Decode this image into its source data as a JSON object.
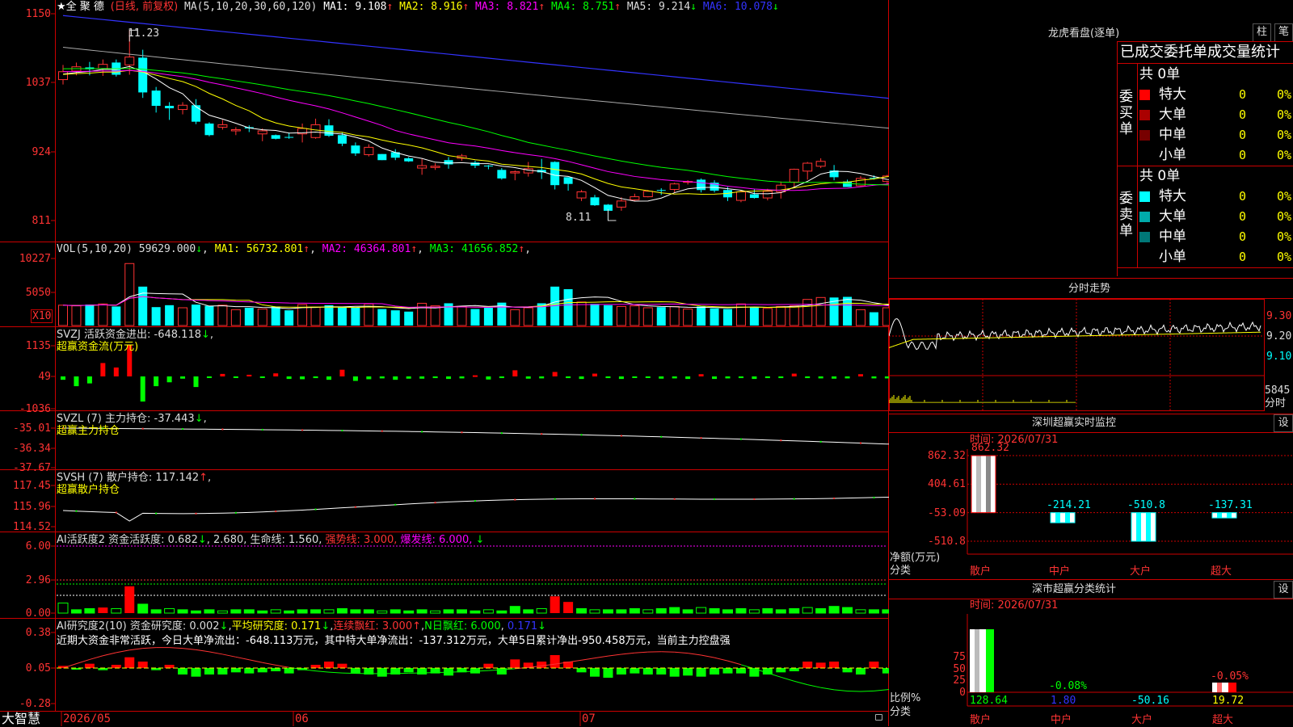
{
  "main_chart": {
    "title": "★全 聚 德",
    "period": "(日线, 前复权)",
    "ma_params": "MA(5,10,20,30,60,120)",
    "ma_values": [
      {
        "label": "MA1:",
        "value": "9.108",
        "arrow": "↑",
        "color": "#ffffff"
      },
      {
        "label": "MA2:",
        "value": "8.916",
        "arrow": "↑",
        "color": "#ffff00"
      },
      {
        "label": "MA3:",
        "value": "8.821",
        "arrow": "↑",
        "color": "#ff00ff"
      },
      {
        "label": "MA4:",
        "value": "8.751",
        "arrow": "↑",
        "color": "#00ff00"
      },
      {
        "label": "MA5:",
        "value": "9.214",
        "arrow": "↓",
        "color": "#dddddd"
      },
      {
        "label": "MA6:",
        "value": "10.078",
        "arrow": "↓",
        "color": "#3333ff"
      }
    ],
    "y_ticks": [
      "1150",
      "1037",
      "924",
      "811"
    ],
    "high_label": "11.23",
    "low_label": "8.11",
    "candles": [
      [
        10.42,
        10.66,
        10.34,
        10.55
      ],
      [
        10.56,
        10.7,
        10.49,
        10.63
      ],
      [
        10.62,
        10.71,
        10.49,
        10.59
      ],
      [
        10.6,
        10.75,
        10.48,
        10.67
      ],
      [
        10.7,
        10.75,
        10.47,
        10.5
      ],
      [
        10.66,
        11.23,
        10.5,
        10.79
      ],
      [
        10.78,
        10.91,
        10.12,
        10.21
      ],
      [
        10.24,
        10.3,
        9.88,
        9.99
      ],
      [
        9.99,
        10.05,
        9.76,
        9.95
      ],
      [
        9.93,
        10.05,
        9.85,
        10.0
      ],
      [
        10.0,
        10.1,
        9.69,
        9.73
      ],
      [
        9.7,
        9.72,
        9.49,
        9.51
      ],
      [
        9.64,
        9.76,
        9.6,
        9.68
      ],
      [
        9.58,
        9.64,
        9.51,
        9.6
      ],
      [
        9.64,
        9.67,
        9.56,
        9.62
      ],
      [
        9.53,
        9.62,
        9.41,
        9.58
      ],
      [
        9.51,
        9.52,
        9.44,
        9.45
      ],
      [
        9.48,
        9.55,
        9.45,
        9.47
      ],
      [
        9.53,
        9.7,
        9.39,
        9.62
      ],
      [
        9.47,
        9.78,
        9.45,
        9.68
      ],
      [
        9.67,
        9.77,
        9.48,
        9.5
      ],
      [
        9.51,
        9.55,
        9.33,
        9.37
      ],
      [
        9.34,
        9.39,
        9.17,
        9.21
      ],
      [
        9.19,
        9.36,
        9.16,
        9.31
      ],
      [
        9.2,
        9.2,
        9.1,
        9.1
      ],
      [
        9.23,
        9.28,
        9.1,
        9.14
      ],
      [
        9.13,
        9.15,
        9.07,
        9.08
      ],
      [
        8.97,
        9.12,
        8.86,
        9.01
      ],
      [
        8.98,
        9.05,
        8.94,
        9.0
      ],
      [
        9.1,
        9.15,
        8.96,
        9.03
      ],
      [
        9.13,
        9.2,
        9.09,
        9.17
      ],
      [
        9.06,
        9.09,
        8.97,
        9.01
      ],
      [
        9.01,
        9.02,
        8.95,
        9.0
      ],
      [
        8.94,
        8.97,
        8.78,
        8.8
      ],
      [
        8.89,
        8.93,
        8.77,
        8.91
      ],
      [
        8.89,
        9.07,
        8.83,
        8.96
      ],
      [
        8.94,
        9.12,
        8.79,
        8.9
      ],
      [
        9.07,
        9.08,
        8.62,
        8.69
      ],
      [
        8.82,
        8.82,
        8.6,
        8.71
      ],
      [
        8.48,
        8.61,
        8.43,
        8.58
      ],
      [
        8.49,
        8.53,
        8.35,
        8.36
      ],
      [
        8.37,
        8.38,
        8.11,
        8.27
      ],
      [
        8.33,
        8.49,
        8.27,
        8.43
      ],
      [
        8.45,
        8.55,
        8.43,
        8.5
      ],
      [
        8.5,
        8.61,
        8.49,
        8.59
      ],
      [
        8.61,
        8.64,
        8.53,
        8.6
      ],
      [
        8.62,
        8.73,
        8.57,
        8.71
      ],
      [
        8.75,
        8.77,
        8.7,
        8.75
      ],
      [
        8.78,
        8.8,
        8.57,
        8.61
      ],
      [
        8.73,
        8.77,
        8.57,
        8.6
      ],
      [
        8.61,
        8.66,
        8.43,
        8.49
      ],
      [
        8.44,
        8.61,
        8.41,
        8.58
      ],
      [
        8.54,
        8.63,
        8.47,
        8.48
      ],
      [
        8.48,
        8.63,
        8.44,
        8.59
      ],
      [
        8.58,
        8.75,
        8.47,
        8.69
      ],
      [
        8.74,
        8.96,
        8.66,
        8.95
      ],
      [
        8.92,
        9.07,
        8.78,
        9.05
      ],
      [
        9.0,
        9.13,
        8.97,
        9.08
      ],
      [
        8.93,
        9.02,
        8.77,
        8.82
      ],
      [
        8.75,
        8.78,
        8.66,
        8.66
      ],
      [
        8.68,
        8.84,
        8.67,
        8.8
      ],
      [
        8.81,
        8.85,
        8.78,
        8.8
      ],
      [
        8.75,
        8.86,
        8.69,
        8.84
      ],
      [
        8.83,
        8.87,
        8.76,
        8.77
      ],
      [
        8.85,
        8.89,
        8.54,
        8.59
      ],
      [
        8.67,
        8.8,
        8.65,
        8.8
      ],
      [
        8.83,
        8.99,
        8.81,
        8.95
      ],
      [
        8.97,
        9.11,
        8.93,
        9.0
      ],
      [
        9.09,
        9.16,
        9.02,
        9.15
      ],
      [
        9.11,
        9.44,
        9.05,
        9.24
      ],
      [
        9.16,
        9.26,
        9.04,
        9.26
      ],
      [
        9.25,
        9.39,
        9.16,
        9.38
      ]
    ]
  },
  "volume": {
    "header": "VOL(5,10,20)",
    "value": "59629.000",
    "arrow": "↓",
    "ma": [
      {
        "label": "MA1:",
        "value": "56732.801",
        "arrow": "↑",
        "color": "#ffff00"
      },
      {
        "label": "MA2:",
        "value": "46364.801",
        "arrow": "↑",
        "color": "#ff00ff"
      },
      {
        "label": "MA3:",
        "value": "41656.852",
        "arrow": "↑",
        "color": "#00ff00"
      }
    ],
    "y_ticks": [
      "10227",
      "5050"
    ],
    "unit": "X10"
  },
  "svzj": {
    "header": "SVZJ  活跃资金进出:",
    "value": "-648.118",
    "arrow": "↓",
    "sub": "超赢资金流(万元)",
    "y_ticks": [
      "1135",
      "49",
      "-1036"
    ]
  },
  "svzl": {
    "header": "SVZL (7) 主力持仓:",
    "value": "-37.443",
    "arrow": "↓",
    "sub": "超赢主力持仓",
    "y_ticks": [
      "-35.01",
      "-36.34",
      "-37.67"
    ]
  },
  "svsh": {
    "header": "SVSH (7) 散户持仓:",
    "value": "117.142",
    "arrow": "↑",
    "sub": "超赢散户持仓",
    "y_ticks": [
      "117.45",
      "115.96",
      "114.52"
    ]
  },
  "ai_active": {
    "header_parts": [
      {
        "text": "AI活跃度2 资金活跃度: 0.682",
        "color": "#dddddd"
      },
      {
        "text": "↓",
        "color": "#00ff00"
      },
      {
        "text": ", 2.680, 生命线: 1.560, ",
        "color": "#dddddd"
      },
      {
        "text": "强势线: 3.000, ",
        "color": "#ff3333"
      },
      {
        "text": "爆发线: 6.000,",
        "color": "#ff00ff"
      },
      {
        "text": "     ↓",
        "color": "#00ff00"
      }
    ],
    "y_ticks": [
      "6.00",
      "2.96",
      "0.00"
    ]
  },
  "ai_research": {
    "header_parts": [
      {
        "text": "AI研究度2(10) 资金研究度: 0.002",
        "color": "#dddddd"
      },
      {
        "text": "↓",
        "color": "#00ff00"
      },
      {
        "text": ",",
        "color": "#dddddd"
      },
      {
        "text": "平均研究度: 0.171",
        "color": "#ffff00"
      },
      {
        "text": "↓",
        "color": "#00ff00"
      },
      {
        "text": ",",
        "color": "#dddddd"
      },
      {
        "text": "连续飘红: 3.000",
        "color": "#ff3333"
      },
      {
        "text": "↑",
        "color": "#ff3333"
      },
      {
        "text": ",",
        "color": "#dddddd"
      },
      {
        "text": "N日飘红: 6.000",
        "color": "#00ff00"
      },
      {
        "text": ", ",
        "color": "#dddddd"
      },
      {
        "text": "0.171",
        "color": "#3333ff"
      },
      {
        "text": "↓",
        "color": "#00ff00"
      }
    ],
    "note": "近期大资金非常活跃，今日大单净流出：-648.113万元，其中特大单净流出：-137.312万元，大单5日累计净出-950.458万元，当前主力控盘强",
    "y_ticks": [
      "0.38",
      "0.05",
      "-0.28"
    ]
  },
  "x_axis": {
    "labels": [
      "2026/05",
      "06",
      "07"
    ]
  },
  "brand": "大智慧",
  "right_panel": {
    "longhu": {
      "title": "龙虎看盘(逐单)",
      "btn_zhu": "柱",
      "btn_bi": "笔",
      "tabs": "已成交委托单成交量统计",
      "buy": {
        "side_label": "委买单",
        "total": "共 0单",
        "rows": [
          {
            "name": "特大",
            "count": "0",
            "pct": "0%",
            "color": "#ff0000"
          },
          {
            "name": "大单",
            "count": "0",
            "pct": "0%",
            "color": "#aa0000"
          },
          {
            "name": "中单",
            "count": "0",
            "pct": "0%",
            "color": "#770000"
          },
          {
            "name": "小单",
            "count": "0",
            "pct": "0%",
            "color": "#000000"
          }
        ]
      },
      "sell": {
        "side_label": "委卖单",
        "total": "共 0单",
        "rows": [
          {
            "name": "特大",
            "count": "0",
            "pct": "0%",
            "color": "#00ffff"
          },
          {
            "name": "大单",
            "count": "0",
            "pct": "0%",
            "color": "#00aaaa"
          },
          {
            "name": "中单",
            "count": "0",
            "pct": "0%",
            "color": "#007777"
          },
          {
            "name": "小单",
            "count": "0",
            "pct": "0%",
            "color": "#000000"
          }
        ]
      }
    },
    "fenshi": {
      "title": "分时走势",
      "ticks": [
        "9.30",
        "9.20",
        "9.10"
      ],
      "vol_label": "5845",
      "label": "分时"
    },
    "sz_monitor": {
      "title": "深圳超赢实时监控",
      "btn": "设",
      "time": "时间: 2026/07/31",
      "y_ticks": [
        "862.32",
        "404.61",
        "-53.09",
        "-510.8"
      ],
      "y_axis_label": "净额(万元)",
      "x_axis_label": "分类",
      "bars": [
        {
          "label": "散户",
          "value": 862.32,
          "text": "862.32"
        },
        {
          "label": "中户",
          "value": -214.21,
          "text": "-214.21"
        },
        {
          "label": "大户",
          "value": -510.8,
          "text": "-510.8"
        },
        {
          "label": "超大",
          "value": -137.31,
          "text": "-137.31"
        }
      ]
    },
    "sz_stats": {
      "title": "深市超赢分类统计",
      "btn": "设",
      "time": "时间: 2026/07/31",
      "y_ticks": [
        "75",
        "50",
        "25",
        "0"
      ],
      "y_axis_label": "比例%",
      "x_axis_label": "分类",
      "bars": [
        {
          "label": "散户",
          "value": "128.64",
          "pct": "",
          "color": "#00ff00"
        },
        {
          "label": "中户",
          "value": "1.80",
          "pct": "-0.08%",
          "color": "#3333ff"
        },
        {
          "label": "大户",
          "value": "-50.16",
          "pct": "",
          "color": "#00ffff"
        },
        {
          "label": "超大",
          "value": "19.72",
          "pct": "-0.05%",
          "color": "#ffff00"
        }
      ]
    }
  }
}
